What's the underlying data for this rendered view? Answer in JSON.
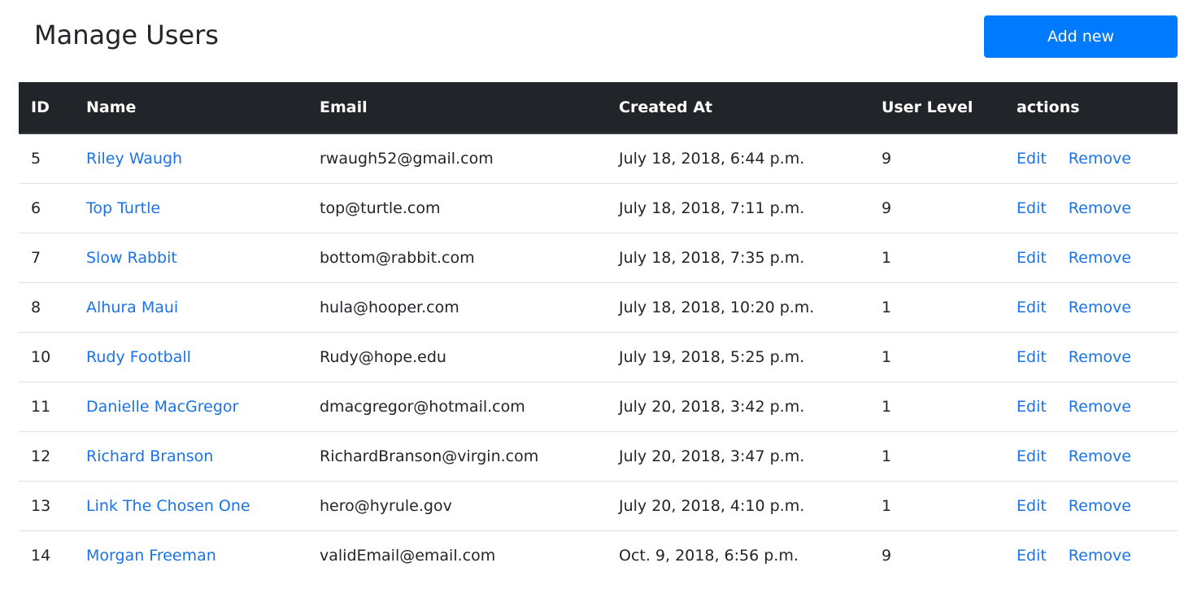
{
  "header": {
    "title": "Manage Users",
    "add_button_label": "Add new"
  },
  "colors": {
    "accent": "#007bff",
    "link": "#1a73e8",
    "table_header_bg": "#212529",
    "row_border": "#dee2e6"
  },
  "table": {
    "columns": {
      "id": "ID",
      "name": "Name",
      "email": "Email",
      "created_at": "Created At",
      "user_level": "User Level",
      "actions": "actions"
    },
    "rows": [
      {
        "id": "5",
        "name": "Riley Waugh",
        "email": "rwaugh52@gmail.com",
        "created_at": "July 18, 2018, 6:44 p.m.",
        "user_level": "9",
        "edit": "Edit",
        "remove": "Remove"
      },
      {
        "id": "6",
        "name": "Top Turtle",
        "email": "top@turtle.com",
        "created_at": "July 18, 2018, 7:11 p.m.",
        "user_level": "9",
        "edit": "Edit",
        "remove": "Remove"
      },
      {
        "id": "7",
        "name": "Slow Rabbit",
        "email": "bottom@rabbit.com",
        "created_at": "July 18, 2018, 7:35 p.m.",
        "user_level": "1",
        "edit": "Edit",
        "remove": "Remove"
      },
      {
        "id": "8",
        "name": "Alhura Maui",
        "email": "hula@hooper.com",
        "created_at": "July 18, 2018, 10:20 p.m.",
        "user_level": "1",
        "edit": "Edit",
        "remove": "Remove"
      },
      {
        "id": "10",
        "name": "Rudy Football",
        "email": "Rudy@hope.edu",
        "created_at": "July 19, 2018, 5:25 p.m.",
        "user_level": "1",
        "edit": "Edit",
        "remove": "Remove"
      },
      {
        "id": "11",
        "name": "Danielle MacGregor",
        "email": "dmacgregor@hotmail.com",
        "created_at": "July 20, 2018, 3:42 p.m.",
        "user_level": "1",
        "edit": "Edit",
        "remove": "Remove"
      },
      {
        "id": "12",
        "name": "Richard Branson",
        "email": "RichardBranson@virgin.com",
        "created_at": "July 20, 2018, 3:47 p.m.",
        "user_level": "1",
        "edit": "Edit",
        "remove": "Remove"
      },
      {
        "id": "13",
        "name": "Link The Chosen One",
        "email": "hero@hyrule.gov",
        "created_at": "July 20, 2018, 4:10 p.m.",
        "user_level": "1",
        "edit": "Edit",
        "remove": "Remove"
      },
      {
        "id": "14",
        "name": "Morgan Freeman",
        "email": "validEmail@email.com",
        "created_at": "Oct. 9, 2018, 6:56 p.m.",
        "user_level": "9",
        "edit": "Edit",
        "remove": "Remove"
      }
    ]
  }
}
